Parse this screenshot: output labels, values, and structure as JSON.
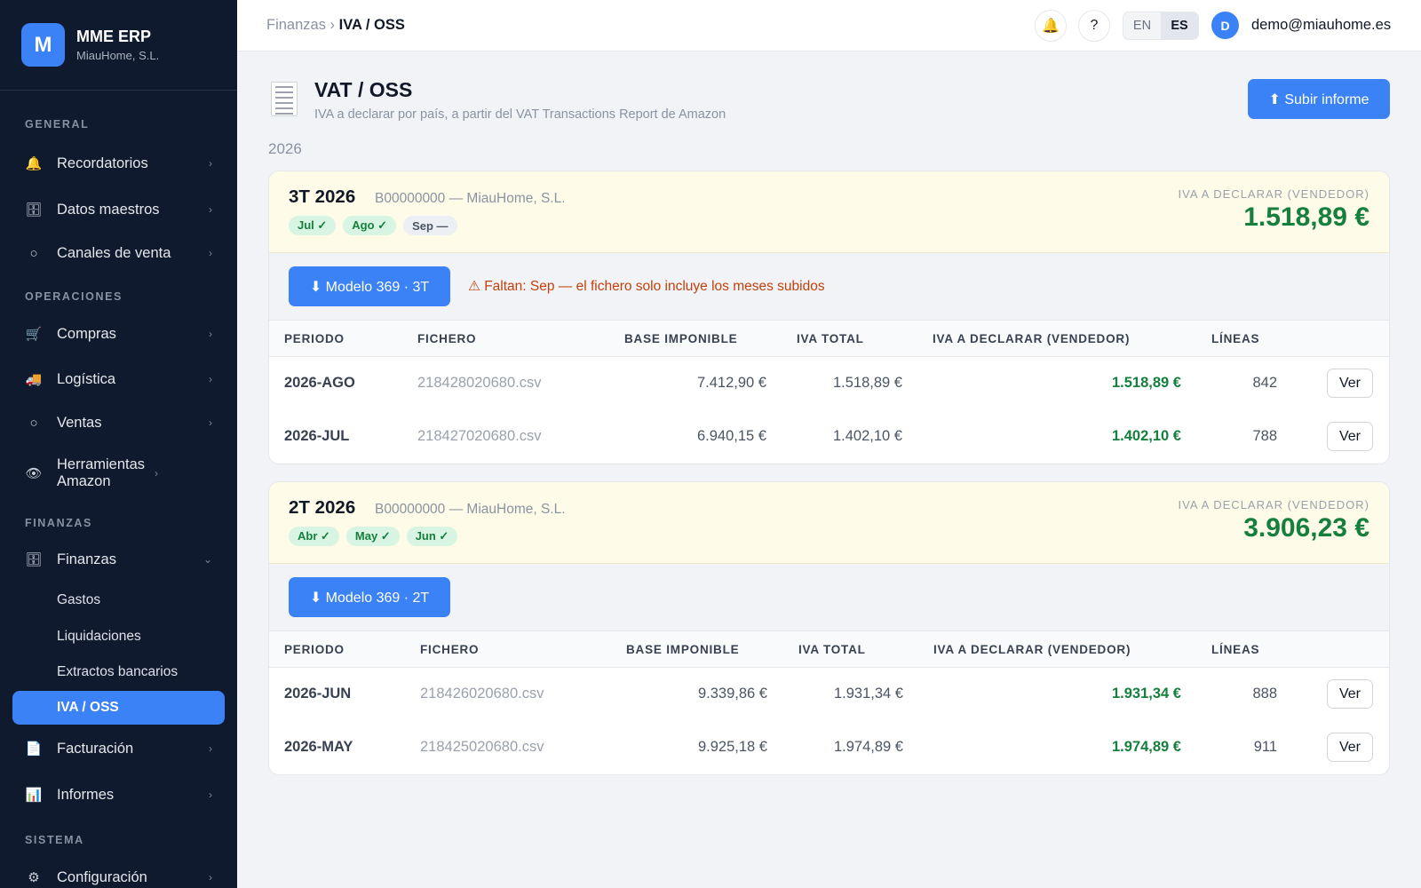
{
  "brand": {
    "logo": "M",
    "name": "MME ERP",
    "company": "MiauHome, S.L."
  },
  "sidebar": {
    "section_general": "GENERAL",
    "section_operaciones": "OPERACIONES",
    "section_finanzas": "FINANZAS",
    "section_sistema": "SISTEMA",
    "items": {
      "recordatorios": "Recordatorios",
      "datos_maestros": "Datos maestros",
      "canales": "Canales de venta",
      "compras": "Compras",
      "logistica": "Logística",
      "ventas": "Ventas",
      "herramientas": "Herramientas Amazon",
      "finanzas": "Finanzas",
      "gastos": "Gastos",
      "liquidaciones": "Liquidaciones",
      "extractos": "Extractos bancarios",
      "iva_oss": "IVA / OSS",
      "facturacion": "Facturación",
      "informes": "Informes",
      "configuracion": "Configuración"
    }
  },
  "topbar": {
    "breadcrumb_parent": "Finanzas",
    "breadcrumb_sep": "›",
    "breadcrumb_current": "IVA / OSS",
    "help": "?",
    "lang_en": "EN",
    "lang_es": "ES",
    "avatar": "D",
    "user_email": "demo@miauhome.es"
  },
  "page": {
    "title": "VAT / OSS",
    "subtitle": "IVA a declarar por país, a partir del VAT Transactions Report de Amazon",
    "upload_button": "⬆ Subir informe",
    "year": "2026"
  },
  "columns": {
    "periodo": "PERIODO",
    "fichero": "FICHERO",
    "base": "BASE IMPONIBLE",
    "iva_total": "IVA TOTAL",
    "iva_declarar": "IVA A DECLARAR (VENDEDOR)",
    "lineas": "LÍNEAS"
  },
  "quarters": [
    {
      "title": "3T 2026",
      "company": "B00000000 — MiauHome, S.L.",
      "months": [
        {
          "label": "Jul ✓",
          "status": "ok"
        },
        {
          "label": "Ago ✓",
          "status": "ok"
        },
        {
          "label": "Sep —",
          "status": "missing"
        }
      ],
      "amount_label": "IVA A DECLARAR (VENDEDOR)",
      "amount": "1.518,89 €",
      "model_button": "⬇ Modelo 369 · 3T",
      "warning": "⚠ Faltan: Sep — el fichero solo incluye los meses subidos",
      "rows": [
        {
          "periodo": "2026-AGO",
          "fichero": "218428020680.csv",
          "base": "7.412,90 €",
          "iva_total": "1.518,89 €",
          "iva_declarar": "1.518,89 €",
          "lineas": "842",
          "action": "Ver"
        },
        {
          "periodo": "2026-JUL",
          "fichero": "218427020680.csv",
          "base": "6.940,15 €",
          "iva_total": "1.402,10 €",
          "iva_declarar": "1.402,10 €",
          "lineas": "788",
          "action": "Ver"
        }
      ]
    },
    {
      "title": "2T 2026",
      "company": "B00000000 — MiauHome, S.L.",
      "months": [
        {
          "label": "Abr ✓",
          "status": "ok"
        },
        {
          "label": "May ✓",
          "status": "ok"
        },
        {
          "label": "Jun ✓",
          "status": "ok"
        }
      ],
      "amount_label": "IVA A DECLARAR (VENDEDOR)",
      "amount": "3.906,23 €",
      "model_button": "⬇ Modelo 369 · 2T",
      "warning": "",
      "rows": [
        {
          "periodo": "2026-JUN",
          "fichero": "218426020680.csv",
          "base": "9.339,86 €",
          "iva_total": "1.931,34 €",
          "iva_declarar": "1.931,34 €",
          "lineas": "888",
          "action": "Ver"
        },
        {
          "periodo": "2026-MAY",
          "fichero": "218425020680.csv",
          "base": "9.925,18 €",
          "iva_total": "1.974,89 €",
          "iva_declarar": "1.974,89 €",
          "lineas": "911",
          "action": "Ver"
        }
      ]
    }
  ],
  "colors": {
    "accent": "#3b82f6",
    "sidebar_bg": "#0f1a2e",
    "positive": "#15803d",
    "warning": "#c2410c",
    "card_head_bg": "#fefbe8"
  }
}
